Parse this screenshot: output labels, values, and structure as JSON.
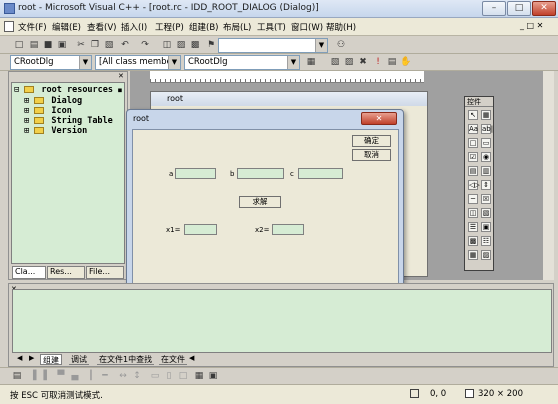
{
  "window": {
    "title": "root - Microsoft Visual C++ - [root.rc - IDD_ROOT_DIALOG (Dialog)]",
    "min_glyph": "–",
    "max_glyph": "□",
    "close_glyph": "✕"
  },
  "menu": [
    {
      "label": "文件(F)"
    },
    {
      "label": "编辑(E)"
    },
    {
      "label": "查看(V)"
    },
    {
      "label": "插入(I)"
    },
    {
      "label": "工程(P)"
    },
    {
      "label": "组建(B)"
    },
    {
      "label": "布局(L)"
    },
    {
      "label": "工具(T)"
    },
    {
      "label": "窗口(W)"
    },
    {
      "label": "帮助(H)"
    }
  ],
  "combos": {
    "class": "CRootDlg",
    "filter": "[All class members]",
    "member": "CRootDlg",
    "find": ""
  },
  "workspace": {
    "root": "root resources",
    "folders": [
      "Dialog",
      "Icon",
      "String Table",
      "Version"
    ],
    "tabs": [
      "Cla...",
      "Res...",
      "File..."
    ]
  },
  "editor": {
    "window_title": "root"
  },
  "dialog": {
    "title": "root",
    "ok_label": "确定",
    "cancel_label": "取消",
    "label_a": "a",
    "label_b": "b",
    "label_c": "c",
    "solve_label": "求解",
    "label_x1": "x1=",
    "label_x2": "x2="
  },
  "controls": {
    "title": "控件",
    "items": [
      "↖",
      "▦",
      "Aa",
      "ab|",
      "□",
      "▭",
      "☑",
      "◉",
      "▤",
      "▥",
      "◁▷",
      "⇕",
      "─",
      "☒",
      "◫",
      "▧",
      "☰",
      "▣",
      "▩",
      "☷",
      "▦",
      "▨"
    ]
  },
  "output": {
    "tabs": [
      "组建",
      "调试",
      "在文件1中查找",
      "在文件"
    ]
  },
  "status": {
    "message": "按 ESC 可取消测试模式.",
    "coords": "0, 0",
    "size": "320 × 200"
  }
}
